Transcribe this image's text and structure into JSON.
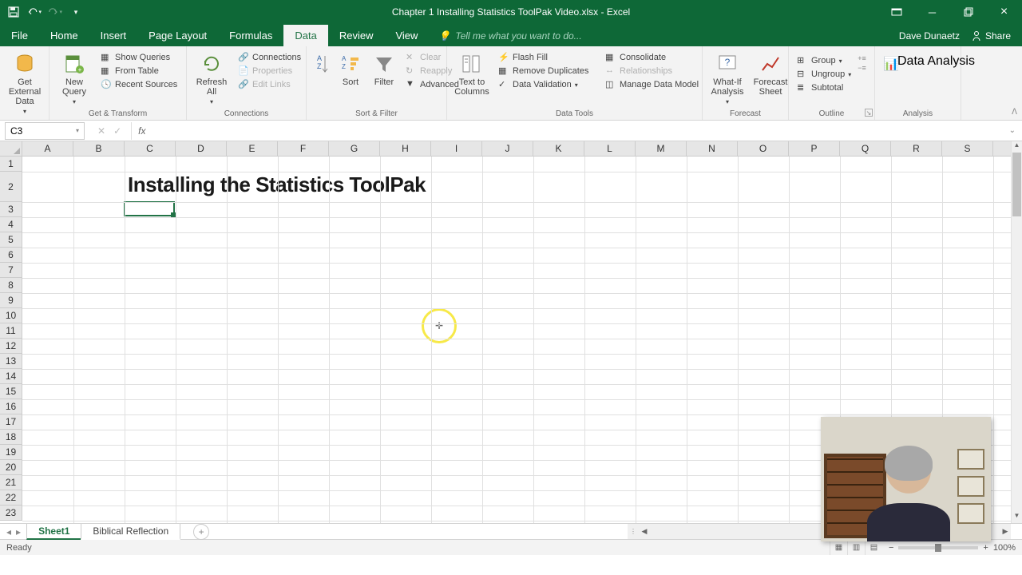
{
  "title": "Chapter 1 Installing Statistics ToolPak Video.xlsx - Excel",
  "user": "Dave Dunaetz",
  "share": "Share",
  "tellme": "Tell me what you want to do...",
  "tabs": [
    "File",
    "Home",
    "Insert",
    "Page Layout",
    "Formulas",
    "Data",
    "Review",
    "View"
  ],
  "active_tab": "Data",
  "ribbon": {
    "get_transform": {
      "label": "Get & Transform",
      "external": "Get External\nData",
      "newquery": "New\nQuery",
      "show_queries": "Show Queries",
      "from_table": "From Table",
      "recent": "Recent Sources"
    },
    "connections": {
      "label": "Connections",
      "refresh": "Refresh\nAll",
      "connections": "Connections",
      "properties": "Properties",
      "edit_links": "Edit Links"
    },
    "sortfilter": {
      "label": "Sort & Filter",
      "sort": "Sort",
      "filter": "Filter",
      "clear": "Clear",
      "reapply": "Reapply",
      "advanced": "Advanced"
    },
    "datatools": {
      "label": "Data Tools",
      "t2c": "Text to\nColumns",
      "flash": "Flash Fill",
      "dup": "Remove Duplicates",
      "valid": "Data Validation",
      "consol": "Consolidate",
      "rel": "Relationships",
      "model": "Manage Data Model"
    },
    "forecast": {
      "label": "Forecast",
      "whatif": "What-If\nAnalysis",
      "fsheet": "Forecast\nSheet"
    },
    "outline": {
      "label": "Outline",
      "group": "Group",
      "ungroup": "Ungroup",
      "subtotal": "Subtotal"
    },
    "analysis": {
      "label": "Analysis",
      "da": "Data Analysis"
    }
  },
  "namebox": "C3",
  "formula": "",
  "columns": [
    "A",
    "B",
    "C",
    "D",
    "E",
    "F",
    "G",
    "H",
    "I",
    "J",
    "K",
    "L",
    "M",
    "N",
    "O",
    "P",
    "Q",
    "R",
    "S"
  ],
  "rows": [
    1,
    2,
    3,
    4,
    5,
    6,
    7,
    8,
    9,
    10,
    11,
    12,
    13,
    14,
    15,
    16,
    17,
    18,
    19,
    20,
    21,
    22,
    23
  ],
  "row_heights": {
    "2": 38
  },
  "content": {
    "C2": "Installing the Statistics ToolPak"
  },
  "selected_cell": "C3",
  "sheet_tabs": [
    "Sheet1",
    "Biblical Reflection"
  ],
  "active_sheet": "Sheet1",
  "status": "Ready",
  "zoom": "100%"
}
